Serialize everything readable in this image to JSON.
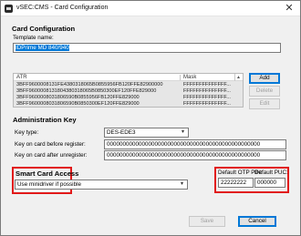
{
  "window": {
    "title": "vSEC:CMS - Card Configuration",
    "close_glyph": "✕"
  },
  "card_configuration": {
    "heading": "Card Configuration",
    "template_name_label": "Template name:",
    "template_name_value": "IDPrime MD 840/940"
  },
  "atr_table": {
    "columns": [
      "ATR",
      "Mask"
    ],
    "sort_glyph": "▲",
    "rows": [
      {
        "atr": "3BFF9600008131FE4380318065B0855956FB120FFE82900000",
        "mask": "FFFFFFFFFFFFFF..."
      },
      {
        "atr": "3BFF9600008131804380318065B0850300EF120FFE829000",
        "mask": "FFFFFFFFFFFFFF..."
      },
      {
        "atr": "3BFF9600008031806590B0855956FB120FFE829000",
        "mask": "FFFFFFFFFFFFFF..."
      },
      {
        "atr": "3BFF9600008031806590B0850300EF120FFE829000",
        "mask": "FFFFFFFFFFFFFF..."
      }
    ]
  },
  "buttons": {
    "add": "Add",
    "delete": "Delete",
    "edit": "Edit",
    "save": "Save",
    "cancel": "Cancel"
  },
  "administration_key": {
    "heading": "Administration Key",
    "key_type_label": "Key type:",
    "key_type_value": "DES-EDE3",
    "before_register_label": "Key on card before register:",
    "before_register_value": "000000000000000000000000000000000000000000000000",
    "after_unregister_label": "Key on card after unregister:",
    "after_unregister_value": "000000000000000000000000000000000000000000000000"
  },
  "smart_card_access": {
    "heading": "Smart Card Access",
    "value": "Use minidriver if possible"
  },
  "defaults": {
    "otp_pin_label": "Default OTP PIN:",
    "otp_pin_value": "22222222",
    "puc_label": "Default PUC:",
    "puc_value": "000000"
  },
  "icons": {
    "dropdown": "▾"
  },
  "colors": {
    "highlight_border": "#e11919",
    "selection": "#0078d7"
  }
}
